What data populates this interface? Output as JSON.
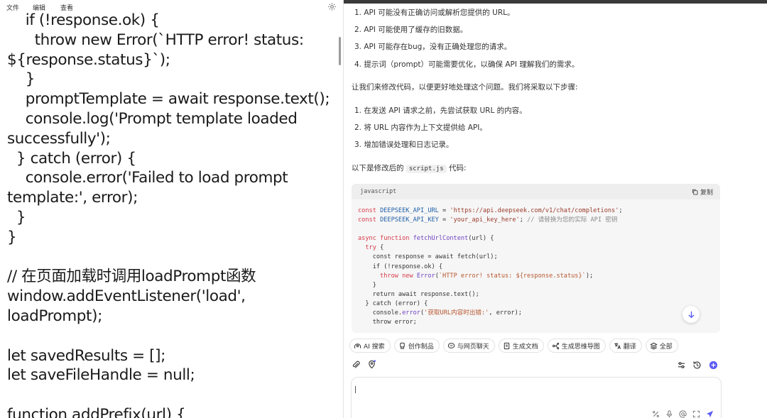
{
  "editor": {
    "menu": [
      "文件",
      "编辑",
      "查看"
    ],
    "lines": [
      "    if (!response.ok) {",
      "      throw new Error(`HTTP error! status:",
      "${response.status}`);",
      "    }",
      "    promptTemplate = await response.text();",
      "    console.log('Prompt template loaded",
      "successfully');",
      "  } catch (error) {",
      "    console.error('Failed to load prompt",
      "template:', error);",
      "  }",
      "}",
      "",
      "// 在页面加载时调用loadPrompt函数",
      "window.addEventListener('load',",
      "loadPrompt);",
      "",
      "let savedResults = [];",
      "let saveFileHandle = null;",
      "",
      "function addPrefix(url) {"
    ]
  },
  "chat": {
    "list1": [
      "1. API 可能没有正确访问或解析您提供的 URL。",
      "2. API 可能使用了缓存的旧数据。",
      "3. API 可能存在bug，没有正确处理您的请求。",
      "4. 提示词（prompt）可能需要优化，以确保 API 理解我们的需求。"
    ],
    "intro": "让我们来修改代码，以便更好地处理这个问题。我们将采取以下步骤:",
    "list2": [
      "1. 在发送 API 请求之前，先尝试获取 URL 的内容。",
      "2. 将 URL 内容作为上下文提供给 API。",
      "3. 增加错误处理和日志记录。"
    ],
    "code_intro_before": "以下是修改后的",
    "code_intro_file": "script.js",
    "code_intro_after": "代码:",
    "code_lang": "javascript",
    "copy_label": "复制",
    "code": {
      "l1_name": "DEEPSEEK_API_URL",
      "l1_value": "'https://api.deepseek.com/v1/chat/completions'",
      "l2_name": "DEEPSEEK_API_KEY",
      "l2_value": "'your_api_key_here'",
      "l2_comment": "// 请替换为您的实际 API 密钥",
      "fn_name": "fetchUrlContent",
      "fn_params": "(url) {",
      "l6": "const response = await fetch(url);",
      "l7": "if (!response.ok) {",
      "l8_err": "`HTTP error! status: ${response.status}`",
      "l10": "return await response.text();",
      "l11": "} catch (error) {",
      "l12_msg": "'获取URL内容时出错:'",
      "l13": "throw error;"
    },
    "tools": [
      "AI 搜索",
      "创作制品",
      "与网页聊天",
      "生成文档",
      "生成思维导图",
      "翻译",
      "全部"
    ]
  },
  "colors": {
    "accent": "#5b5bf5",
    "divider": "#e3e3e3"
  }
}
